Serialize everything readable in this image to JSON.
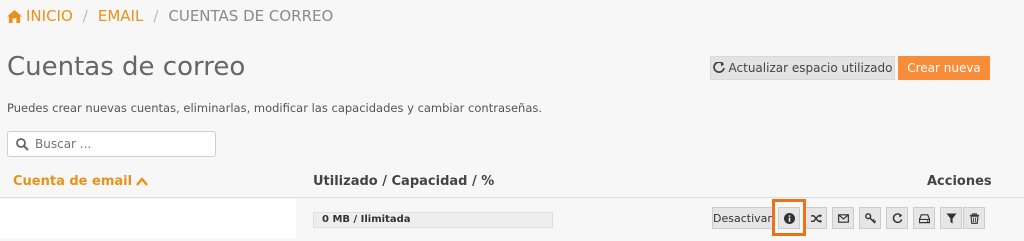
{
  "breadcrumb": {
    "home": "INICIO",
    "email": "EMAIL",
    "current": "CUENTAS DE CORREO",
    "separator": "/"
  },
  "page": {
    "title": "Cuentas de correo",
    "description": "Puedes crear nuevas cuentas, eliminarlas, modificar las capacidades y cambiar contraseñas."
  },
  "toolbar": {
    "refresh_label": "Actualizar espacio utilizado",
    "create_label": "Crear nueva"
  },
  "search": {
    "placeholder": "Buscar ..."
  },
  "table": {
    "columns": {
      "email": "Cuenta de email",
      "usage": "Utilizado / Capacidad / %",
      "actions": "Acciones"
    },
    "rows": [
      {
        "email": "",
        "usage_label": "0 MB / Ilimitada",
        "usage_fraction": 0,
        "deactivate_label": "Desactivar"
      }
    ]
  },
  "colors": {
    "accent": "#e8911b",
    "primary_button": "#f78d38",
    "highlight": "#e8731b"
  },
  "icons": {
    "home": "home-icon",
    "refresh": "refresh-icon",
    "search": "search-icon",
    "sort": "chevron-up-icon",
    "row_actions": [
      "info-icon",
      "shuffle-icon",
      "envelope-icon",
      "key-icon",
      "refresh-icon",
      "hdd-icon",
      "filter-icon",
      "trash-icon"
    ]
  }
}
